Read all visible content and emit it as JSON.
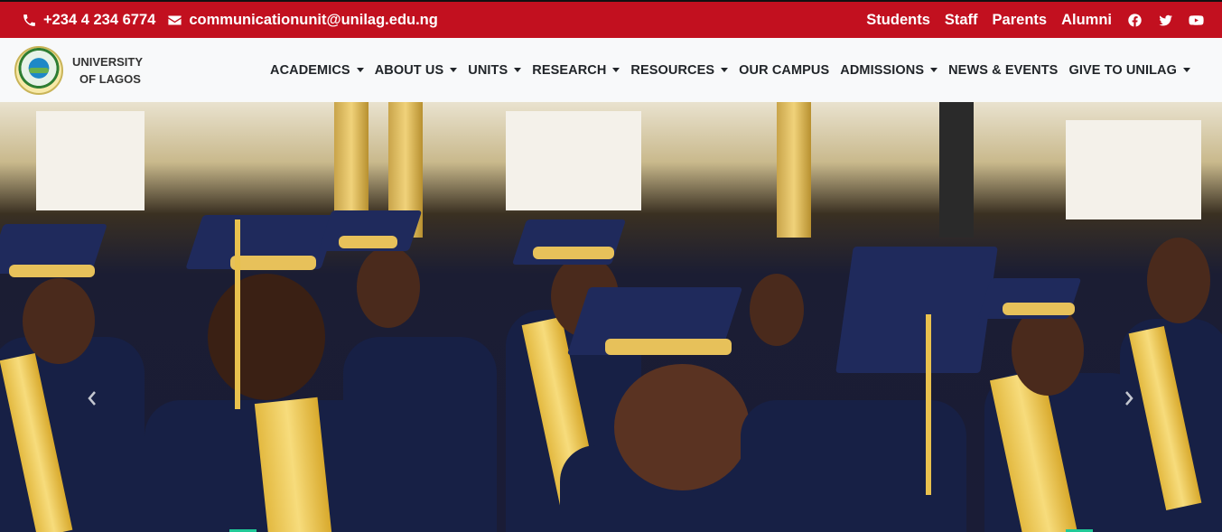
{
  "topbar": {
    "phone": "+234 4 234 6774",
    "email": "communicationunit@unilag.edu.ng",
    "links": [
      "Students",
      "Staff",
      "Parents",
      "Alumni"
    ],
    "social_icons": [
      "facebook-icon",
      "twitter-icon",
      "youtube-icon"
    ],
    "background_color": "#c2101f"
  },
  "brand": {
    "line1": "UNIVERSITY",
    "line2": "OF LAGOS"
  },
  "nav": {
    "items": [
      {
        "label": "ACADEMICS",
        "dropdown": true
      },
      {
        "label": "ABOUT US",
        "dropdown": true
      },
      {
        "label": "UNITS",
        "dropdown": true
      },
      {
        "label": "RESEARCH",
        "dropdown": true
      },
      {
        "label": "RESOURCES",
        "dropdown": true
      },
      {
        "label": "OUR CAMPUS",
        "dropdown": false
      },
      {
        "label": "ADMISSIONS",
        "dropdown": true
      },
      {
        "label": "NEWS & EVENTS",
        "dropdown": false
      },
      {
        "label": "GIVE TO UNILAG",
        "dropdown": true
      }
    ]
  },
  "hero": {
    "controls": [
      "chevron-left-icon",
      "chevron-right-icon"
    ]
  }
}
